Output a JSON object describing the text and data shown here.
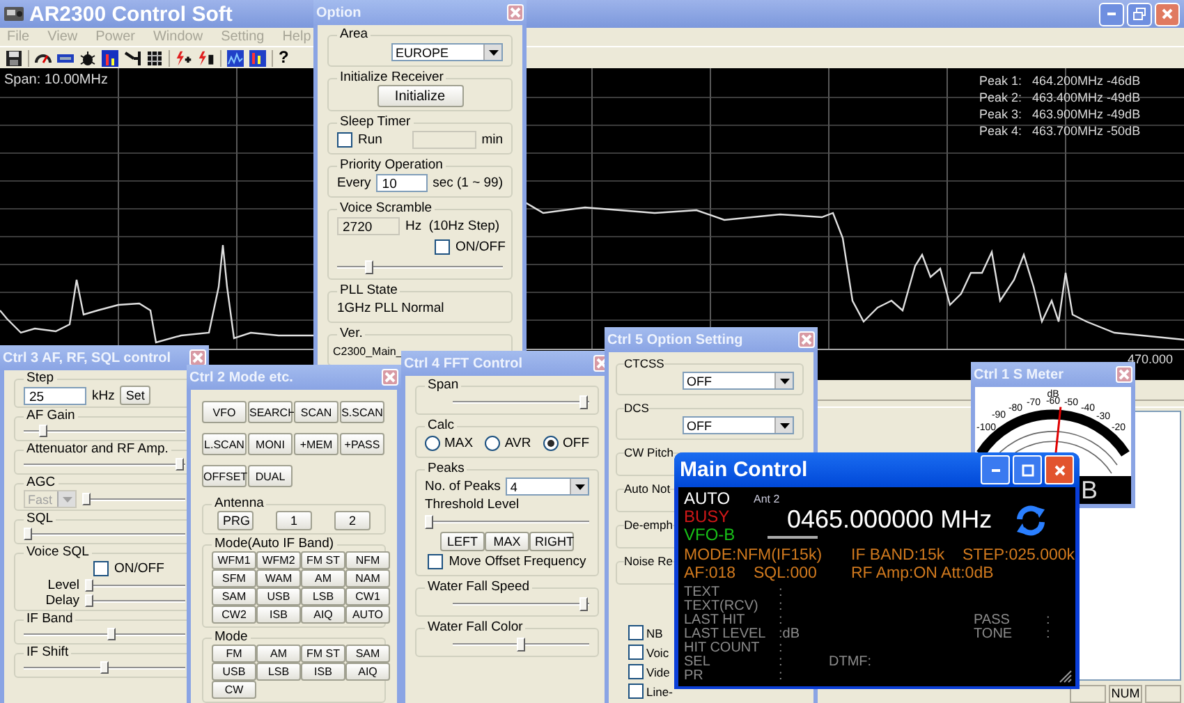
{
  "app": {
    "title": "AR2300 Control Soft",
    "active": false,
    "menu": [
      {
        "label": "File",
        "disabled": true
      },
      {
        "label": "View",
        "disabled": true
      },
      {
        "label": "Power",
        "disabled": true
      },
      {
        "label": "Window",
        "disabled": true
      },
      {
        "label": "Setting",
        "disabled": true
      },
      {
        "label": "Help",
        "disabled": true
      }
    ],
    "help_glyph": "?"
  },
  "spectrum": {
    "span": "Span:  10.00MHz",
    "peaks": [
      "Peak 1:   464.200MHz -46dB",
      "Peak 2:   463.400MHz -49dB",
      "Peak 3:   463.900MHz -49dB",
      "Peak 4:   463.700MHz -50dB"
    ],
    "axis_label": "470.000"
  },
  "status_bar": {
    "indicator": "NUM"
  },
  "option": {
    "title": "Option",
    "active": false,
    "area_label": "Area",
    "area_value": "EUROPE",
    "init_label": "Initialize Receiver",
    "init_button": "Initialize",
    "sleep_label": "Sleep Timer",
    "sleep_run": {
      "label": "Run",
      "checked": false
    },
    "sleep_unit": "min",
    "priority_label": "Priority Operation",
    "priority_prefix": "Every",
    "priority_value": "10",
    "priority_unit": "sec (1 ~ 99)",
    "scramble_label": "Voice Scramble",
    "scramble_value": "2720",
    "scramble_unit": "Hz  (10Hz Step)",
    "scramble_toggle": {
      "label": "ON/OFF",
      "checked": false
    },
    "scramble_slider": {
      "level": 0.18
    },
    "pll_label": "PLL State",
    "pll_state": "1GHz PLL Normal",
    "ver_label": "Ver.",
    "ver_value": "C2300_Main_"
  },
  "ctrl3": {
    "title": "Ctrl 3 AF, RF, SQL control",
    "active": false,
    "step": {
      "label": "Step",
      "value": "25",
      "unit": "kHz",
      "button": "Set"
    },
    "af_gain": {
      "label": "AF Gain",
      "level": 0.1
    },
    "attenuator": {
      "label": "Attenuator and RF Amp.",
      "level": 1
    },
    "agc": {
      "label": "AGC",
      "value": "Fast",
      "disabled": true,
      "level": 0
    },
    "sql": {
      "label": "SQL",
      "level": 0
    },
    "voice_sql": {
      "label": "Voice SQL",
      "toggle": {
        "label": "ON/OFF",
        "checked": false
      },
      "sliders": [
        {
          "label": "Level",
          "level": 0
        },
        {
          "label": "Delay",
          "level": 0
        }
      ]
    },
    "if_band": {
      "label": "IF Band",
      "level": 0.55
    },
    "if_shift": {
      "label": "IF Shift",
      "level": 0.5
    }
  },
  "ctrl2": {
    "title": "Ctrl 2  Mode etc.",
    "active": false,
    "function_buttons": [
      [
        "VFO",
        "SEARCH",
        "SCAN",
        "S.SCAN"
      ],
      [
        "L.SCAN",
        "MONI",
        "+MEM",
        "+PASS"
      ],
      [
        "OFFSET",
        "DUAL"
      ]
    ],
    "antenna": {
      "label": "Antenna",
      "buttons": [
        "PRG",
        "1",
        "2"
      ]
    },
    "auto_mode": {
      "label": "Mode(Auto IF Band)",
      "buttons": [
        "WFM1",
        "WFM2",
        "FM ST",
        "NFM",
        "SFM",
        "WAM",
        "AM",
        "NAM",
        "SAM",
        "USB",
        "LSB",
        "CW1",
        "CW2",
        "ISB",
        "AIQ",
        "AUTO"
      ]
    },
    "mode": {
      "label": "Mode",
      "buttons": [
        "FM",
        "AM",
        "FM ST",
        "SAM",
        "USB",
        "LSB",
        "ISB",
        "AIQ",
        "CW"
      ]
    }
  },
  "ctrl4": {
    "title": "Ctrl 4  FFT Control",
    "active": false,
    "span": {
      "label": "Span",
      "level": 1
    },
    "calc": {
      "label": "Calc",
      "options": [
        {
          "label": "MAX",
          "selected": false
        },
        {
          "label": "AVR",
          "selected": false
        },
        {
          "label": "OFF",
          "selected": true
        }
      ]
    },
    "peaks": {
      "label": "Peaks",
      "count_label": "No. of Peaks",
      "count_value": "4",
      "threshold_label": "Threshold Level",
      "level": 0,
      "buttons": [
        "LEFT",
        "MAX",
        "RIGHT"
      ],
      "offset": {
        "label": "Move Offset Frequency",
        "checked": false
      }
    },
    "waterfall_speed": {
      "label": "Water Fall Speed",
      "level": 1
    },
    "waterfall_color": {
      "label": "Water Fall Color",
      "level": 0.5
    }
  },
  "ctrl5": {
    "title": "Ctrl 5 Option Setting",
    "active": false,
    "ctcss": {
      "label": "CTCSS",
      "value": "OFF"
    },
    "dcs": {
      "label": "DCS",
      "value": "OFF"
    },
    "cw_pitch": {
      "label": "CW Pitch"
    },
    "groups": [
      "Auto Not",
      "De-emph",
      "Noise Re"
    ],
    "checks": [
      {
        "label": "NB",
        "checked": false
      },
      {
        "label": "Voic",
        "checked": false
      },
      {
        "label": "Vide",
        "checked": false
      },
      {
        "label": "Line-",
        "checked": false
      }
    ]
  },
  "smeter": {
    "title": "Ctrl 1  S Meter",
    "active": false,
    "unit": "dB",
    "scale": [
      "-100",
      "-90",
      "-80",
      "-70",
      "-60",
      "-50",
      "-40",
      "-30",
      "-20"
    ],
    "level": 0.55,
    "reading": "B"
  },
  "main_control": {
    "title": "Main Control",
    "active": true,
    "status": [
      {
        "text": "AUTO",
        "color": "#ffffff"
      },
      {
        "text": "BUSY",
        "color": "#d01818"
      },
      {
        "text": "VFO-B",
        "color": "#18c018"
      }
    ],
    "antenna": "Ant 2",
    "frequency": "0465.000000 MHz",
    "readouts": [
      [
        "MODE:NFM(IF15k)",
        "IF BAND:15k",
        "STEP:025.000k"
      ],
      [
        "AF:018",
        "SQL:000",
        "RF Amp:ON Att:0dB"
      ]
    ],
    "info": [
      {
        "label": "TEXT",
        "value": ":"
      },
      {
        "label": "TEXT(RCV)",
        "value": ":"
      },
      {
        "label": "LAST HIT",
        "value": ":",
        "right_label": "PASS",
        "right_value": ":"
      },
      {
        "label": "LAST LEVEL",
        "value": ":dB",
        "right_label": "TONE",
        "right_value": ":"
      },
      {
        "label": "HIT COUNT",
        "value": ":"
      },
      {
        "label": "SEL",
        "value": ":",
        "extra": "DTMF:"
      },
      {
        "label": "PR",
        "value": ":"
      }
    ]
  }
}
